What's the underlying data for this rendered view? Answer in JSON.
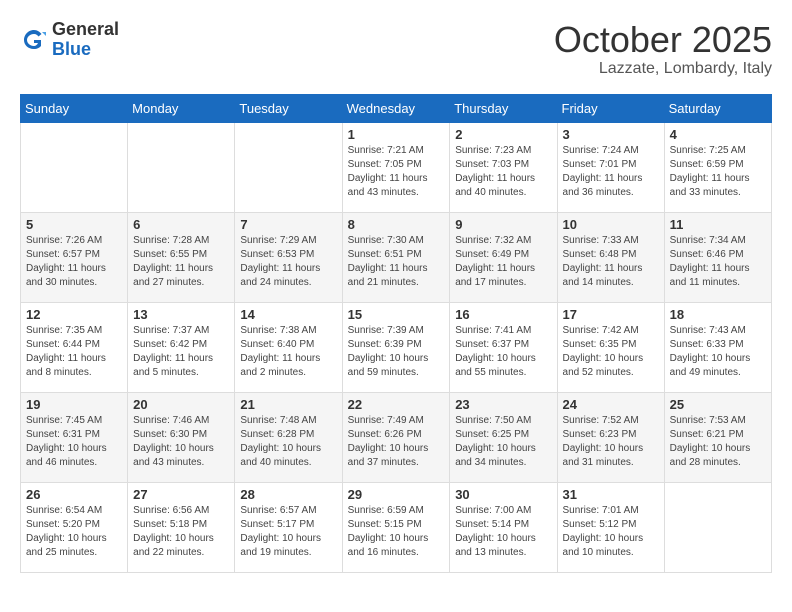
{
  "header": {
    "logo_general": "General",
    "logo_blue": "Blue",
    "month": "October 2025",
    "location": "Lazzate, Lombardy, Italy"
  },
  "weekdays": [
    "Sunday",
    "Monday",
    "Tuesday",
    "Wednesday",
    "Thursday",
    "Friday",
    "Saturday"
  ],
  "weeks": [
    [
      {
        "day": "",
        "info": ""
      },
      {
        "day": "",
        "info": ""
      },
      {
        "day": "",
        "info": ""
      },
      {
        "day": "1",
        "info": "Sunrise: 7:21 AM\nSunset: 7:05 PM\nDaylight: 11 hours\nand 43 minutes."
      },
      {
        "day": "2",
        "info": "Sunrise: 7:23 AM\nSunset: 7:03 PM\nDaylight: 11 hours\nand 40 minutes."
      },
      {
        "day": "3",
        "info": "Sunrise: 7:24 AM\nSunset: 7:01 PM\nDaylight: 11 hours\nand 36 minutes."
      },
      {
        "day": "4",
        "info": "Sunrise: 7:25 AM\nSunset: 6:59 PM\nDaylight: 11 hours\nand 33 minutes."
      }
    ],
    [
      {
        "day": "5",
        "info": "Sunrise: 7:26 AM\nSunset: 6:57 PM\nDaylight: 11 hours\nand 30 minutes."
      },
      {
        "day": "6",
        "info": "Sunrise: 7:28 AM\nSunset: 6:55 PM\nDaylight: 11 hours\nand 27 minutes."
      },
      {
        "day": "7",
        "info": "Sunrise: 7:29 AM\nSunset: 6:53 PM\nDaylight: 11 hours\nand 24 minutes."
      },
      {
        "day": "8",
        "info": "Sunrise: 7:30 AM\nSunset: 6:51 PM\nDaylight: 11 hours\nand 21 minutes."
      },
      {
        "day": "9",
        "info": "Sunrise: 7:32 AM\nSunset: 6:49 PM\nDaylight: 11 hours\nand 17 minutes."
      },
      {
        "day": "10",
        "info": "Sunrise: 7:33 AM\nSunset: 6:48 PM\nDaylight: 11 hours\nand 14 minutes."
      },
      {
        "day": "11",
        "info": "Sunrise: 7:34 AM\nSunset: 6:46 PM\nDaylight: 11 hours\nand 11 minutes."
      }
    ],
    [
      {
        "day": "12",
        "info": "Sunrise: 7:35 AM\nSunset: 6:44 PM\nDaylight: 11 hours\nand 8 minutes."
      },
      {
        "day": "13",
        "info": "Sunrise: 7:37 AM\nSunset: 6:42 PM\nDaylight: 11 hours\nand 5 minutes."
      },
      {
        "day": "14",
        "info": "Sunrise: 7:38 AM\nSunset: 6:40 PM\nDaylight: 11 hours\nand 2 minutes."
      },
      {
        "day": "15",
        "info": "Sunrise: 7:39 AM\nSunset: 6:39 PM\nDaylight: 10 hours\nand 59 minutes."
      },
      {
        "day": "16",
        "info": "Sunrise: 7:41 AM\nSunset: 6:37 PM\nDaylight: 10 hours\nand 55 minutes."
      },
      {
        "day": "17",
        "info": "Sunrise: 7:42 AM\nSunset: 6:35 PM\nDaylight: 10 hours\nand 52 minutes."
      },
      {
        "day": "18",
        "info": "Sunrise: 7:43 AM\nSunset: 6:33 PM\nDaylight: 10 hours\nand 49 minutes."
      }
    ],
    [
      {
        "day": "19",
        "info": "Sunrise: 7:45 AM\nSunset: 6:31 PM\nDaylight: 10 hours\nand 46 minutes."
      },
      {
        "day": "20",
        "info": "Sunrise: 7:46 AM\nSunset: 6:30 PM\nDaylight: 10 hours\nand 43 minutes."
      },
      {
        "day": "21",
        "info": "Sunrise: 7:48 AM\nSunset: 6:28 PM\nDaylight: 10 hours\nand 40 minutes."
      },
      {
        "day": "22",
        "info": "Sunrise: 7:49 AM\nSunset: 6:26 PM\nDaylight: 10 hours\nand 37 minutes."
      },
      {
        "day": "23",
        "info": "Sunrise: 7:50 AM\nSunset: 6:25 PM\nDaylight: 10 hours\nand 34 minutes."
      },
      {
        "day": "24",
        "info": "Sunrise: 7:52 AM\nSunset: 6:23 PM\nDaylight: 10 hours\nand 31 minutes."
      },
      {
        "day": "25",
        "info": "Sunrise: 7:53 AM\nSunset: 6:21 PM\nDaylight: 10 hours\nand 28 minutes."
      }
    ],
    [
      {
        "day": "26",
        "info": "Sunrise: 6:54 AM\nSunset: 5:20 PM\nDaylight: 10 hours\nand 25 minutes."
      },
      {
        "day": "27",
        "info": "Sunrise: 6:56 AM\nSunset: 5:18 PM\nDaylight: 10 hours\nand 22 minutes."
      },
      {
        "day": "28",
        "info": "Sunrise: 6:57 AM\nSunset: 5:17 PM\nDaylight: 10 hours\nand 19 minutes."
      },
      {
        "day": "29",
        "info": "Sunrise: 6:59 AM\nSunset: 5:15 PM\nDaylight: 10 hours\nand 16 minutes."
      },
      {
        "day": "30",
        "info": "Sunrise: 7:00 AM\nSunset: 5:14 PM\nDaylight: 10 hours\nand 13 minutes."
      },
      {
        "day": "31",
        "info": "Sunrise: 7:01 AM\nSunset: 5:12 PM\nDaylight: 10 hours\nand 10 minutes."
      },
      {
        "day": "",
        "info": ""
      }
    ]
  ]
}
